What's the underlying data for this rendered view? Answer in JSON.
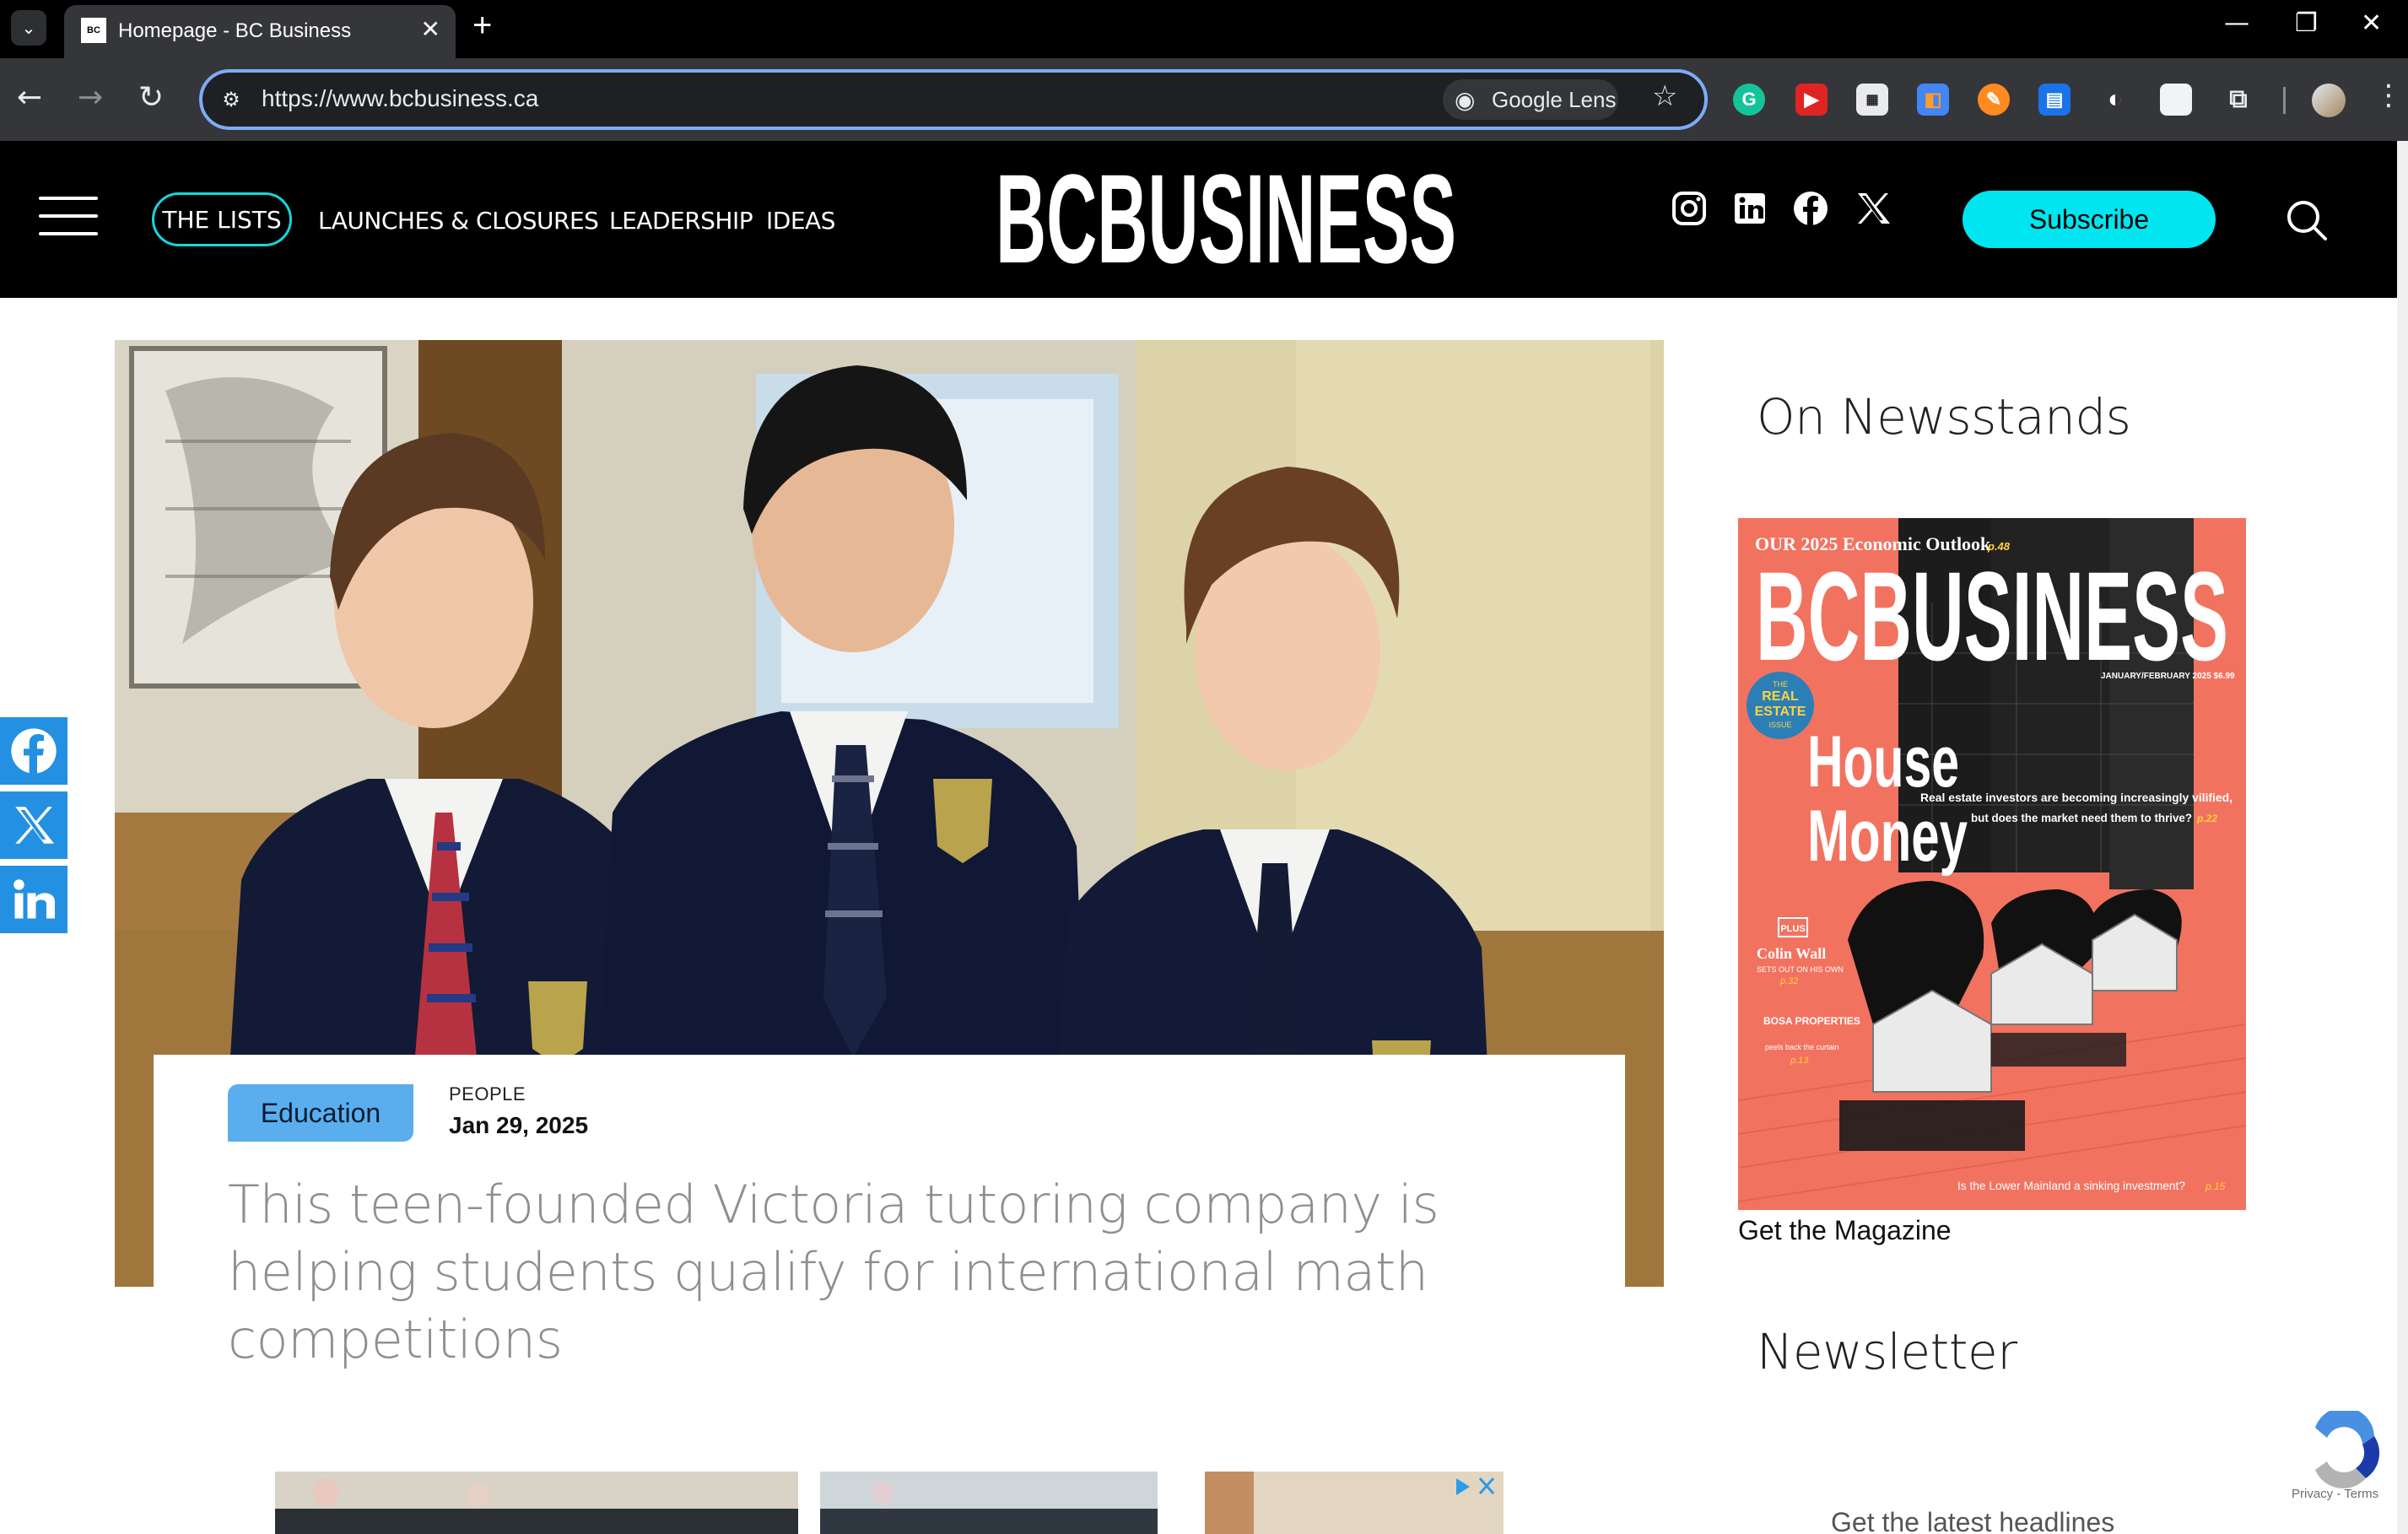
{
  "browser": {
    "tab_title": "Homepage - BC Business",
    "favicon_text": "BC",
    "url": "https://www.bcbusiness.ca",
    "lens_label": "Google Lens"
  },
  "site": {
    "logo_text": "BCBUSINESS",
    "nav": {
      "pill_label": "THE LISTS",
      "links": [
        "LAUNCHES & CLOSURES",
        "LEADERSHIP",
        "IDEAS"
      ]
    },
    "subscribe_label": "Subscribe"
  },
  "article": {
    "category": "Education",
    "kicker": "PEOPLE",
    "date": "Jan 29, 2025",
    "headline": "This teen-founded Victoria tutoring company is helping students qualify for international math competitions"
  },
  "sidebar": {
    "newsstands_heading": "On Newsstands",
    "magazine": {
      "top_line": "OUR 2025 Economic Outlook",
      "top_page": "p.48",
      "masthead": "BCBUSINESS",
      "issue": "JANUARY/FEBRUARY 2025  $6.99",
      "badge_lines": [
        "THE",
        "REAL",
        "ESTATE",
        "ISSUE"
      ],
      "headline_1": "House",
      "headline_2": "Money",
      "dek_1": "Real estate investors are becoming increasingly vilified,",
      "dek_2": "but does the market need them to thrive?",
      "dek_page": "p.22",
      "plus_label": "PLUS",
      "side_1_title": "Colin Wall",
      "side_1_sub": "SETS OUT ON HIS OWN",
      "side_1_page": "p.32",
      "side_2_title": "BOSA PROPERTIES",
      "side_2_sub": "peels back the curtain",
      "side_2_page": "p.13",
      "bottom_line": "Is the Lower Mainland a sinking investment?",
      "bottom_page": "p.15"
    },
    "get_magazine": "Get the Magazine",
    "newsletter_heading": "Newsletter",
    "newsletter_sub": "Get the latest headlines"
  },
  "recaptcha": {
    "privacy": "Privacy",
    "terms": "Terms"
  },
  "colors": {
    "accent_cyan": "#00e6f0",
    "nav_pill_border": "#16d6dd",
    "category_badge": "#5aaeee",
    "share_blue": "#2490e2",
    "magazine_coral": "#f27260"
  }
}
